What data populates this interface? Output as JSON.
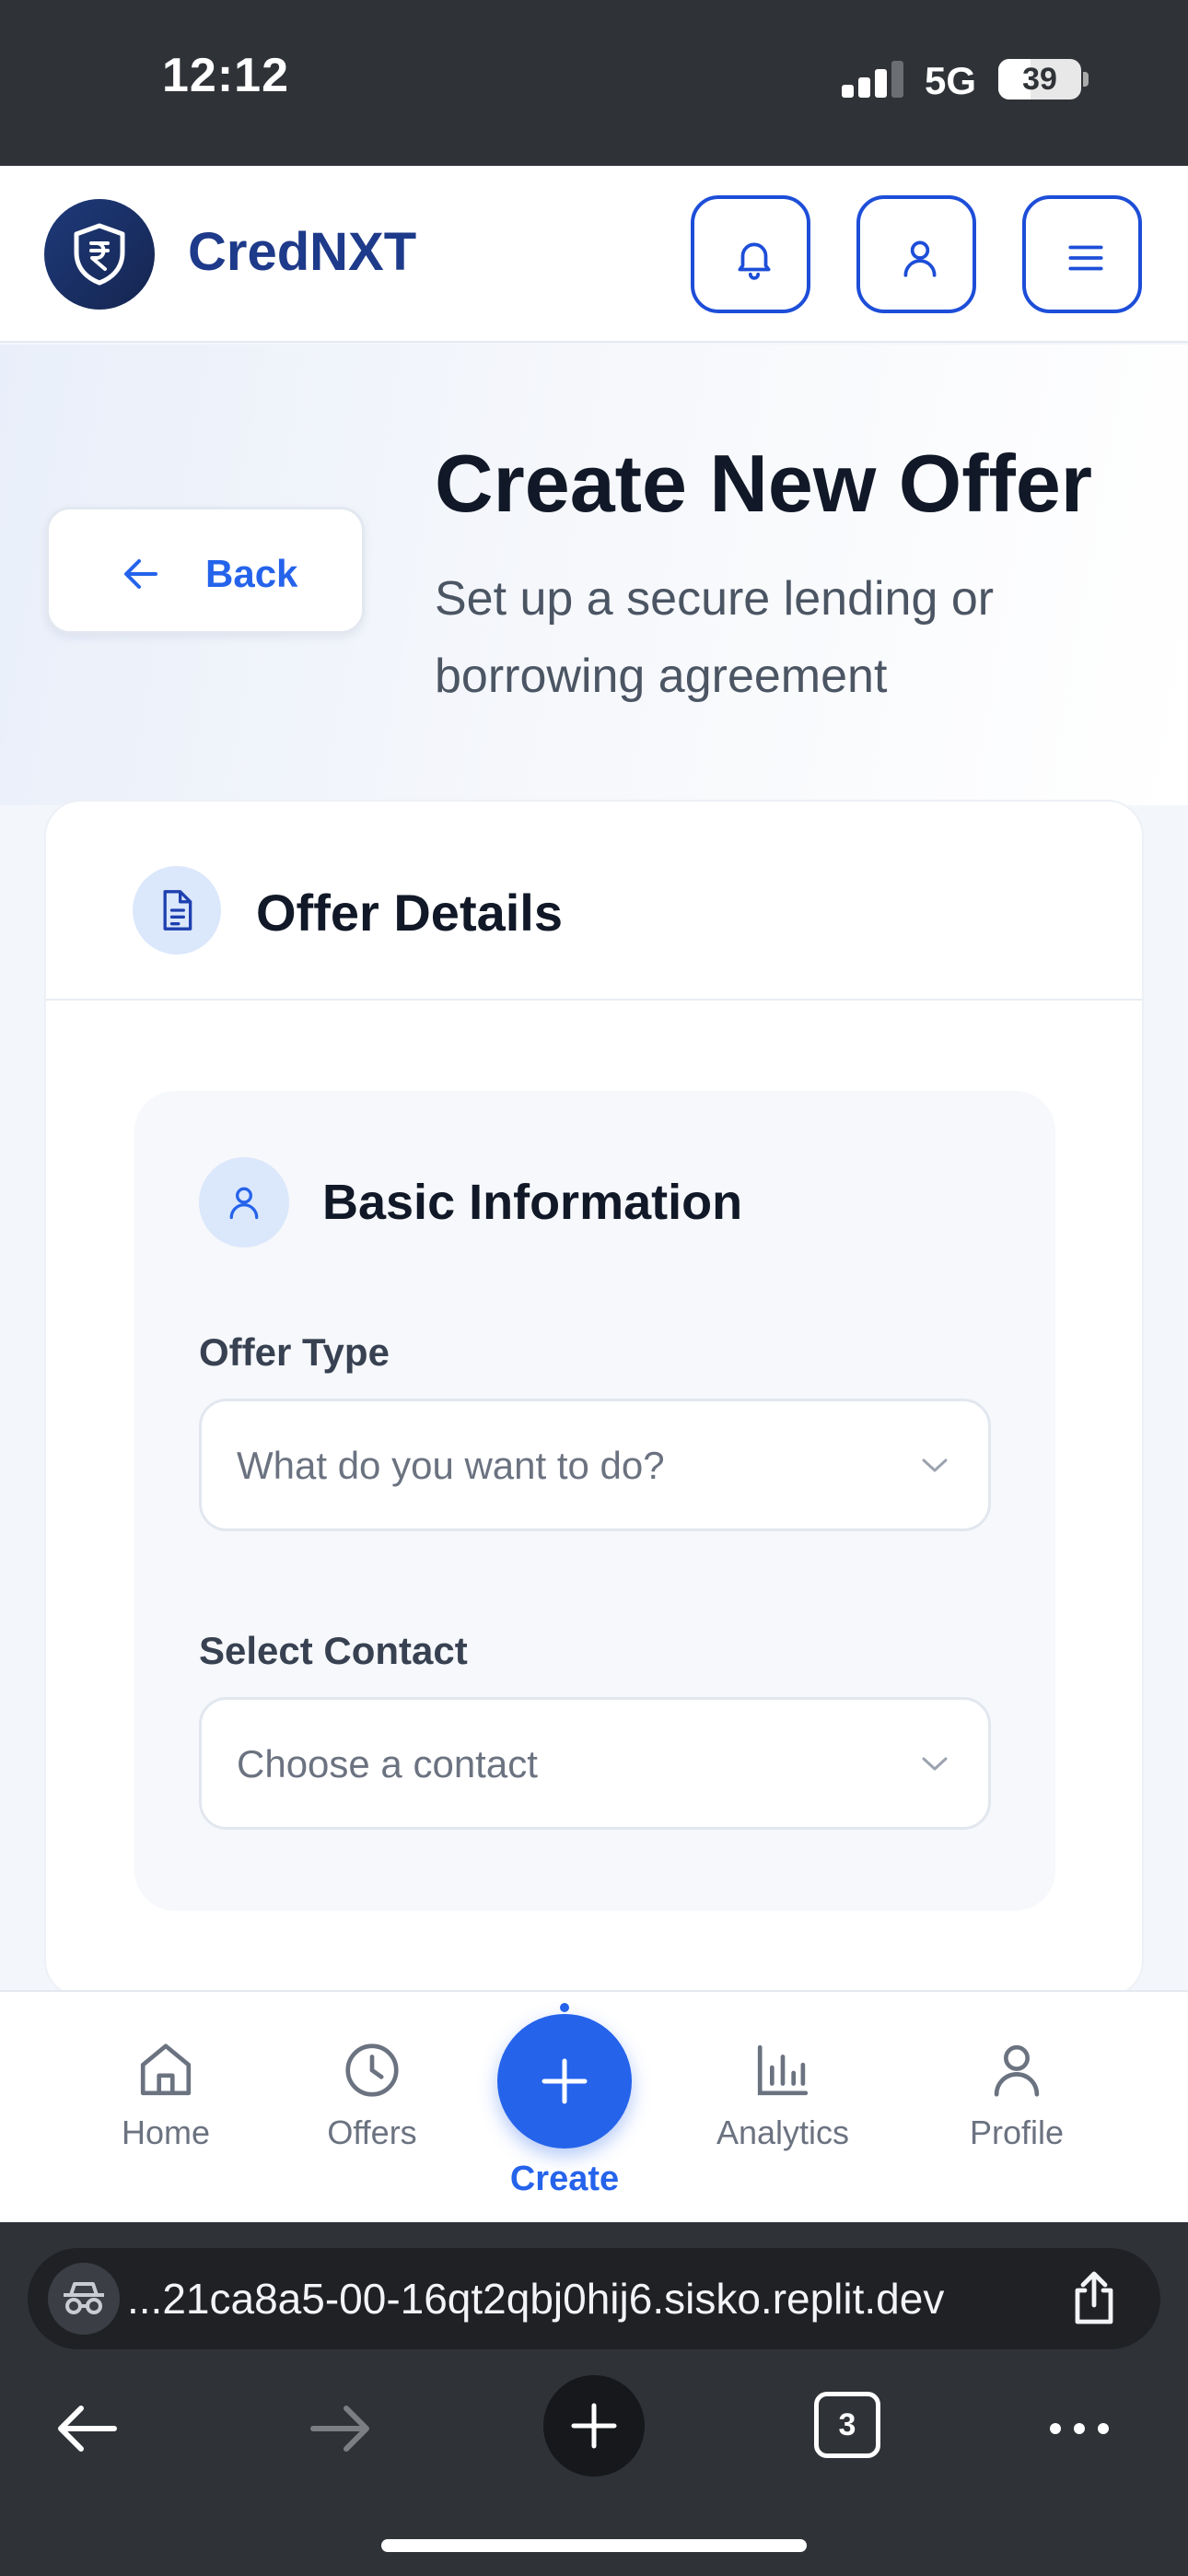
{
  "status_bar": {
    "time": "12:12",
    "network": "5G",
    "battery": "39",
    "battery_level": 0.39
  },
  "header": {
    "brand": "CredNXT",
    "buttons": [
      "bell-icon",
      "user-icon",
      "menu-icon"
    ]
  },
  "hero": {
    "back_label": "Back",
    "title": "Create New Offer",
    "subtitle": "Set up a secure lending or borrowing agreement"
  },
  "card": {
    "title": "Offer Details",
    "section": {
      "title": "Basic Information",
      "fields": [
        {
          "label": "Offer Type",
          "placeholder": "What do you want to do?"
        },
        {
          "label": "Select Contact",
          "placeholder": "Choose a contact"
        }
      ]
    }
  },
  "bottom_nav": {
    "items": [
      {
        "label": "Home",
        "icon": "home-icon"
      },
      {
        "label": "Offers",
        "icon": "clock-icon"
      },
      {
        "label": "Create",
        "icon": "plus-icon",
        "active": true
      },
      {
        "label": "Analytics",
        "icon": "bar-chart-icon"
      },
      {
        "label": "Profile",
        "icon": "user-icon"
      }
    ]
  },
  "browser": {
    "url": "...21ca8a5-00-16qt2qbj0hij6.sisko.replit.dev",
    "tab_count": "3"
  },
  "colors": {
    "brand": "#1e3a8a",
    "accent": "#2563eb",
    "text": "#111827",
    "muted": "#6b7280"
  }
}
